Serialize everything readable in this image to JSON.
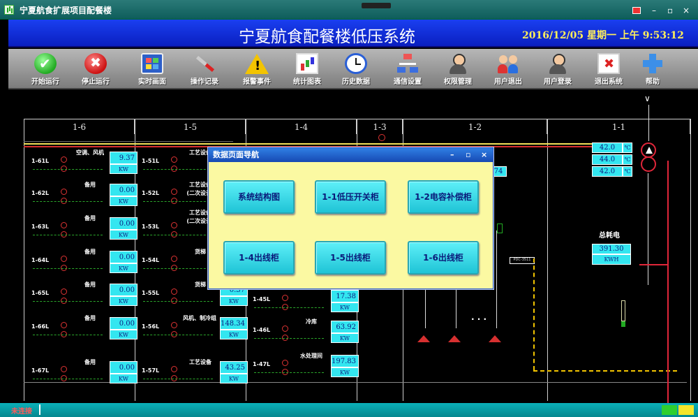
{
  "window": {
    "title": "宁夏航食扩展项目配餐楼",
    "controls": {
      "minimize": "–",
      "restore": "▫",
      "close": "×"
    }
  },
  "header": {
    "title": "宁夏航食配餐楼低压系统",
    "datetime": "2016/12/05 星期一 上午 9:53:12"
  },
  "toolbar": [
    {
      "label": "开始运行",
      "icon": "check-icon"
    },
    {
      "label": "停止运行",
      "icon": "stop-icon"
    },
    {
      "label": "实时画面",
      "icon": "screen-icon"
    },
    {
      "label": "操作记录",
      "icon": "screwdriver-icon"
    },
    {
      "label": "报警事件",
      "icon": "warning-icon"
    },
    {
      "label": "统计图表",
      "icon": "chart-icon"
    },
    {
      "label": "历史数据",
      "icon": "clock-icon"
    },
    {
      "label": "通信设置",
      "icon": "network-icon"
    },
    {
      "label": "权限管理",
      "icon": "user-admin-icon"
    },
    {
      "label": "用户退出",
      "icon": "users-icon"
    },
    {
      "label": "用户登录",
      "icon": "user-login-icon"
    },
    {
      "label": "退出系统",
      "icon": "exit-icon"
    },
    {
      "label": "帮助",
      "icon": "help-icon"
    }
  ],
  "sections": [
    "1-6",
    "1-5",
    "1-4",
    "1-3",
    "1-2",
    "1-1"
  ],
  "cabinet_1_6": [
    {
      "id": "1-61L",
      "name": "空调、风机",
      "value": "9.37",
      "unit": "KW"
    },
    {
      "id": "1-62L",
      "name": "备用",
      "value": "0.00",
      "unit": "KW"
    },
    {
      "id": "1-63L",
      "name": "备用",
      "value": "0.00",
      "unit": "KW"
    },
    {
      "id": "1-64L",
      "name": "备用",
      "value": "0.00",
      "unit": "KW"
    },
    {
      "id": "1-65L",
      "name": "备用",
      "value": "0.00",
      "unit": "KW"
    },
    {
      "id": "1-66L",
      "name": "备用",
      "value": "0.00",
      "unit": "KW"
    },
    {
      "id": "1-67L",
      "name": "备用",
      "value": "0.00",
      "unit": "KW"
    }
  ],
  "cabinet_1_5": [
    {
      "id": "1-51L",
      "name": "工艺设备"
    },
    {
      "id": "1-52L",
      "name": "工艺设备\n(二次设计)"
    },
    {
      "id": "1-53L",
      "name": "工艺设备\n(二次设计)"
    },
    {
      "id": "1-54L",
      "name": "货梯"
    },
    {
      "id": "1-55L",
      "name": "货梯",
      "value": "0.37",
      "unit": "KW"
    },
    {
      "id": "1-56L",
      "name": "风机、制冷组",
      "value": "148.34",
      "unit": "KW"
    },
    {
      "id": "1-57L",
      "name": "工艺设备",
      "value": "43.25",
      "unit": "KW"
    }
  ],
  "cabinet_1_4": [
    {
      "id": "1-45L",
      "name": "",
      "value": "17.38",
      "unit": "KW"
    },
    {
      "id": "1-46L",
      "name": "冷库",
      "value": "63.92",
      "unit": "KW"
    },
    {
      "id": "1-47L",
      "name": "水处理间",
      "value": "197.83",
      "unit": "KW"
    }
  ],
  "cabinet_1_2": {
    "partial_value": "74",
    "dots": "· · ·",
    "tag": "PDC-3511"
  },
  "transformer": {
    "temps": [
      {
        "value": "42.0",
        "unit": "℃"
      },
      {
        "value": "44.0",
        "unit": "℃"
      },
      {
        "value": "42.0",
        "unit": "℃"
      }
    ],
    "total_label": "总耗电",
    "total_value": "391.30",
    "total_unit": "KWH",
    "arrow": "∨"
  },
  "popup": {
    "title": "数据页面导航",
    "controls": {
      "minimize": "–",
      "restore": "▫",
      "close": "×"
    },
    "buttons": [
      "系统结构图",
      "1-1低压开关柜",
      "1-2电容补偿柜",
      "1-4出线柜",
      "1-5出线柜",
      "1-6出线柜"
    ]
  },
  "statusbar": {
    "text": "未连接"
  },
  "colors": {
    "value_cell": "#33e6f0",
    "header_blue": "#1a3ff0",
    "popup_bg": "#fbf9a2",
    "busbar_red": "#e0263a"
  }
}
